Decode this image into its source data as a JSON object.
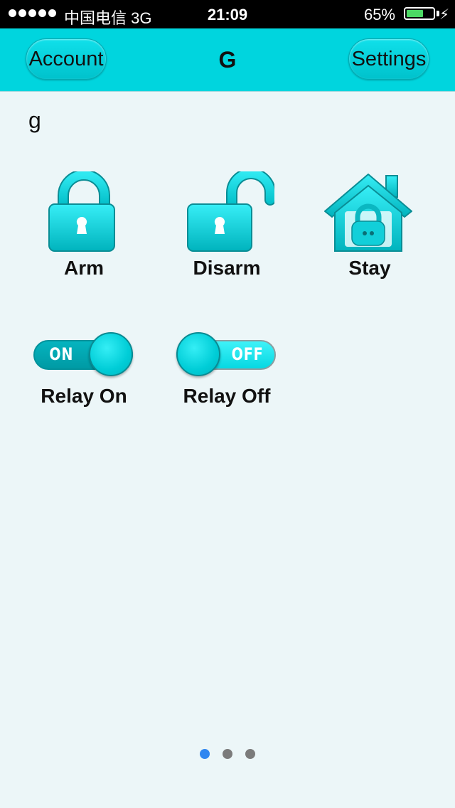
{
  "status_bar": {
    "carrier": "中国电信  3G",
    "time": "21:09",
    "battery_percent": "65%",
    "battery_level": 0.65
  },
  "nav": {
    "account_label": "Account",
    "title": "G",
    "settings_label": "Settings"
  },
  "device": {
    "name": "g"
  },
  "controls": {
    "arm_label": "Arm",
    "disarm_label": "Disarm",
    "stay_label": "Stay",
    "relay_on_label": "Relay On",
    "relay_on_switch_text": "ON",
    "relay_off_label": "Relay Off",
    "relay_off_switch_text": "OFF"
  },
  "pager": {
    "pages": 3,
    "current": 1
  },
  "colors": {
    "accent": "#00d5de",
    "active_dot": "#2f86f0",
    "inactive_dot": "#7b7b7b"
  }
}
